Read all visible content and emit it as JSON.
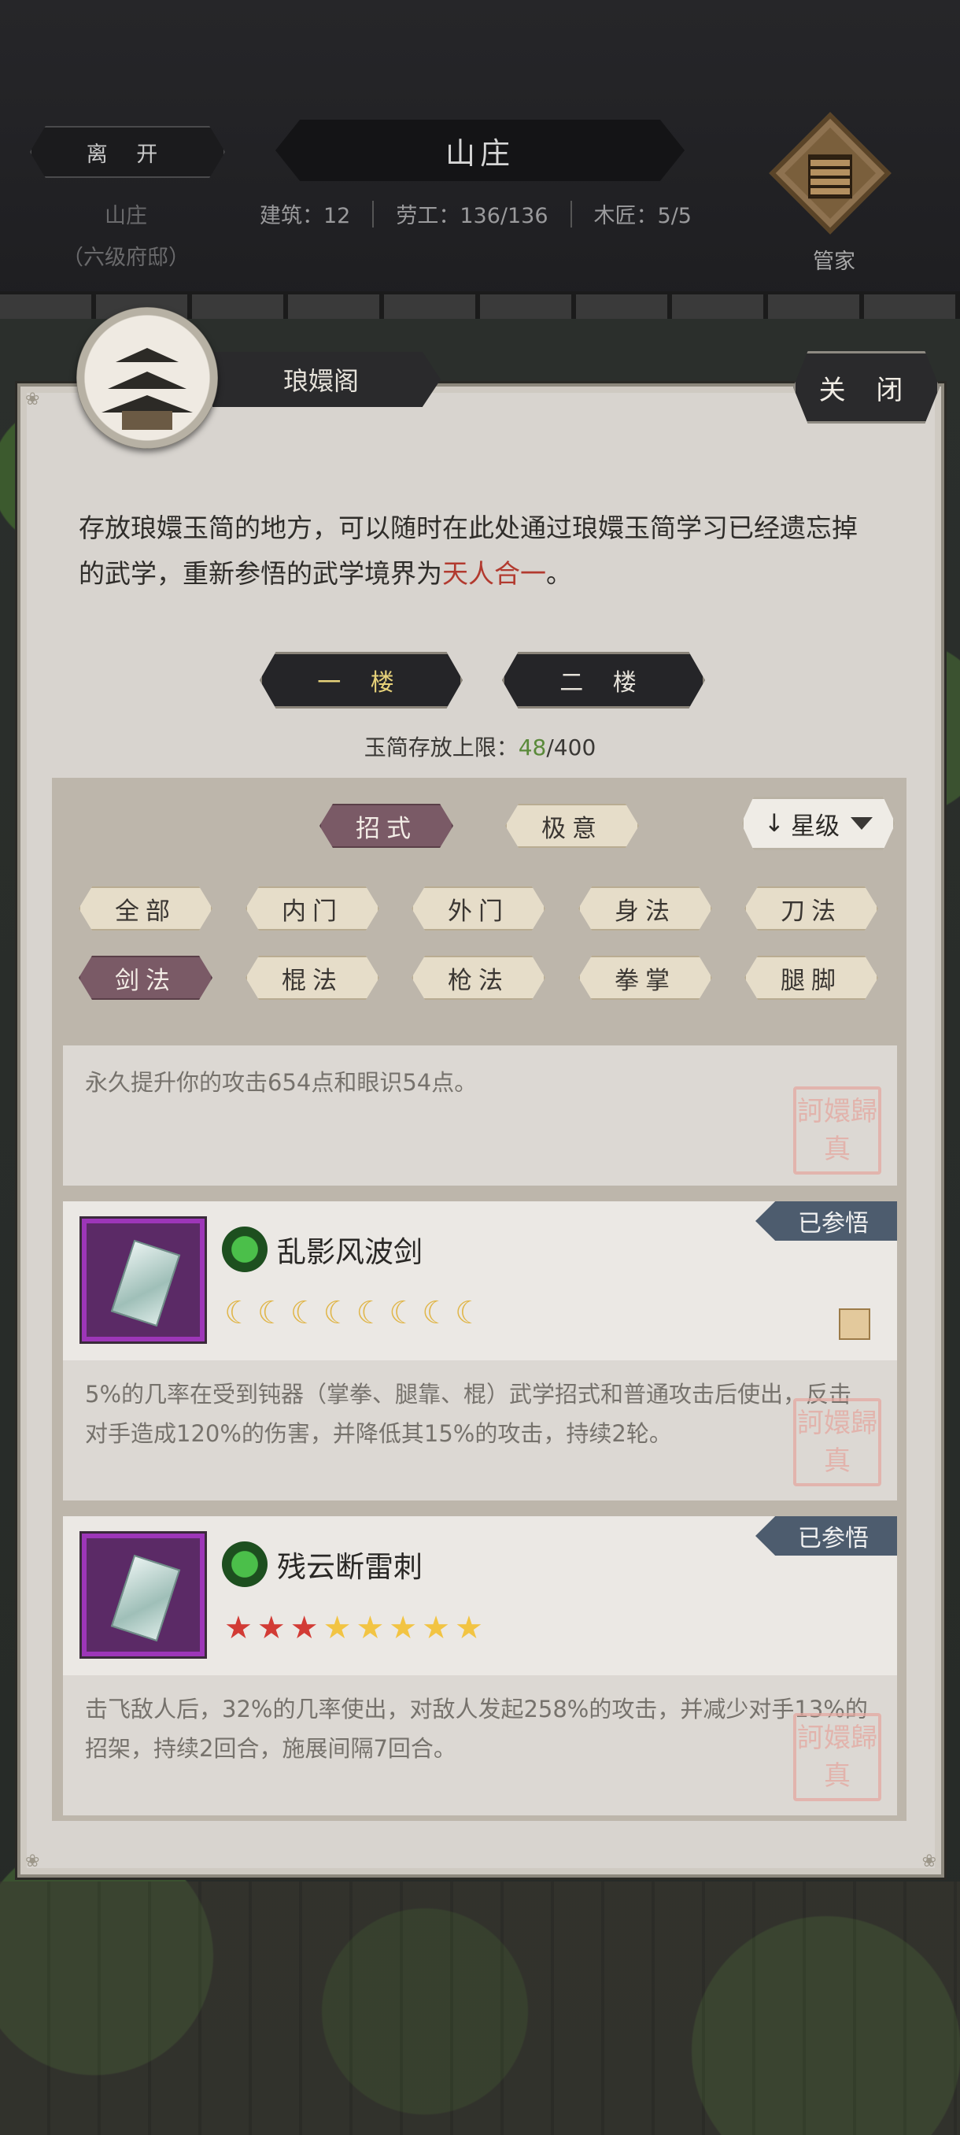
{
  "header": {
    "leave_label": "离 开",
    "title": "山庄",
    "location_name": "山庄",
    "location_rank": "（六级府邸）",
    "stats": {
      "buildings": "建筑：12",
      "labor": "劳工：136/136",
      "carpenters": "木匠：5/5"
    },
    "butler_label": "管家"
  },
  "panel": {
    "building_name": "琅嬛阁",
    "close_label": "关 闭",
    "description_main": "存放琅嬛玉简的地方，可以随时在此处通过琅嬛玉简学习已经遗忘掉的武学，重新参悟的武学境界为",
    "description_highlight": "天人合一",
    "description_end": "。",
    "floors": [
      "一 楼",
      "二 楼"
    ],
    "capacity_label": "玉简存放上限：",
    "capacity_current": "48",
    "capacity_max": "/400"
  },
  "filters": {
    "mode_tabs": [
      "招式",
      "极意"
    ],
    "sort_label": "星级",
    "categories_row1": [
      "全部",
      "内门",
      "外门",
      "身法",
      "刀法"
    ],
    "categories_row2": [
      "剑法",
      "棍法",
      "枪法",
      "拳掌",
      "腿脚"
    ]
  },
  "cards": [
    {
      "effect": "永久提升你的攻击654点和眼识54点。",
      "seal_text": "訶嬛歸真"
    },
    {
      "name": "乱影风波剑",
      "badge": "已参悟",
      "rating": "8 moons",
      "effect": "5%的几率在受到钝器（掌拳、腿靠、棍）武学招式和普通攻击后使出，反击对手造成120%的伤害，并降低其15%的攻击，持续2轮。",
      "seal_text": "訶嬛歸真"
    },
    {
      "name": "残云断雷刺",
      "badge": "已参悟",
      "rating": "3 red stars, 5 gold stars",
      "effect": "击飞敌人后，32%的几率使出，对敌人发起258%的攻击，并减少对手13%的招架，持续2回合，施展间隔7回合。",
      "seal_text": "訶嬛歸真"
    }
  ],
  "colors": {
    "highlight": "#b23a2f",
    "capacity_number": "#5a8a3a",
    "active_chip": "#7a5a66",
    "badge": "#4d5c6e",
    "rarity_purple": "#9d36b8"
  }
}
